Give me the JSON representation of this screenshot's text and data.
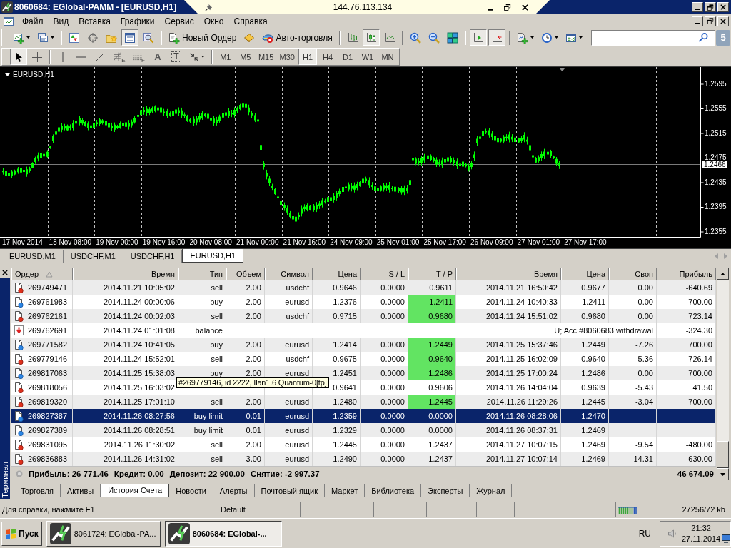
{
  "window": {
    "title": "8060684: EGlobal-PAMM - [EURUSD,H1]"
  },
  "remote_bar": {
    "address": "144.76.113.134"
  },
  "menu": [
    "Файл",
    "Вид",
    "Вставка",
    "Графики",
    "Сервис",
    "Окно",
    "Справка"
  ],
  "toolbar": [
    [
      {
        "kind": "new-chart",
        "on": false
      },
      {
        "kind": "profiles",
        "on": false
      }
    ],
    [
      {
        "kind": "market-watch",
        "on": false
      },
      {
        "kind": "navigator",
        "on": false
      },
      {
        "kind": "favorites",
        "on": false
      },
      {
        "kind": "terminal",
        "on": true
      },
      {
        "kind": "tester",
        "on": false
      }
    ],
    [
      {
        "kind": "new-order",
        "label": "Новый Ордер",
        "on": false
      },
      {
        "kind": "metaeditor",
        "on": false
      },
      {
        "kind": "auto-trading",
        "label": "Авто-торговля",
        "on": false
      }
    ],
    [
      {
        "kind": "bar-chart",
        "on": false
      },
      {
        "kind": "candle-chart",
        "on": true
      },
      {
        "kind": "line-chart",
        "on": false
      }
    ],
    [
      {
        "kind": "zoom-in",
        "on": false
      },
      {
        "kind": "zoom-out",
        "on": false
      },
      {
        "kind": "tile",
        "on": false
      }
    ],
    [
      {
        "kind": "auto-scroll",
        "on": true
      },
      {
        "kind": "chart-shift",
        "on": true
      }
    ],
    [
      {
        "kind": "indicators",
        "on": false
      },
      {
        "kind": "periods",
        "on": false
      },
      {
        "kind": "templates",
        "on": false
      }
    ]
  ],
  "notifications": "5",
  "drawing_tools": [
    [
      {
        "kind": "cursor",
        "on": true
      },
      {
        "kind": "crosshair",
        "on": false
      }
    ],
    [
      {
        "kind": "vertical-line",
        "on": false
      },
      {
        "kind": "horizontal-line",
        "on": false
      },
      {
        "kind": "trend-line",
        "on": false
      },
      {
        "kind": "fibonacci",
        "glyph": "E",
        "on": false
      },
      {
        "kind": "fibonacci-lines",
        "glyph": "F",
        "on": false
      },
      {
        "kind": "text",
        "glyph": "A",
        "on": false
      },
      {
        "kind": "label",
        "glyph": "T",
        "on": false
      },
      {
        "kind": "arrows",
        "on": false
      }
    ]
  ],
  "timeframes": [
    {
      "label": "M1",
      "selected": false
    },
    {
      "label": "M5",
      "selected": false
    },
    {
      "label": "M15",
      "selected": false
    },
    {
      "label": "M30",
      "selected": false
    },
    {
      "label": "H1",
      "selected": true
    },
    {
      "label": "H4",
      "selected": false
    },
    {
      "label": "D1",
      "selected": false
    },
    {
      "label": "W1",
      "selected": false
    },
    {
      "label": "MN",
      "selected": false
    }
  ],
  "chart": {
    "label": "EURUSD,H1",
    "price_scale": [
      "1.2595",
      "1.2555",
      "1.2515",
      "1.2475",
      "1.2435",
      "1.2395",
      "1.2355"
    ],
    "current_price": "1.2466",
    "time_scale": [
      "17 Nov 2014",
      "18 Nov 08:00",
      "19 Nov 00:00",
      "19 Nov 16:00",
      "20 Nov 08:00",
      "21 Nov 00:00",
      "21 Nov 16:00",
      "24 Nov 09:00",
      "25 Nov 01:00",
      "25 Nov 17:00",
      "26 Nov 09:00",
      "27 Nov 01:00",
      "27 Nov 17:00"
    ]
  },
  "chart_tabs": [
    {
      "label": "EURUSD,M1",
      "selected": false
    },
    {
      "label": "USDCHF,M1",
      "selected": false
    },
    {
      "label": "USDCHF,H1",
      "selected": false
    },
    {
      "label": "EURUSD,H1",
      "selected": true
    }
  ],
  "terminal": {
    "title": "Терминал",
    "columns": [
      {
        "label": "Ордер",
        "sorted": true
      },
      {
        "label": "Время",
        "sorted": false
      },
      {
        "label": "Тип",
        "sorted": false
      },
      {
        "label": "Объем",
        "sorted": false
      },
      {
        "label": "Символ",
        "sorted": false
      },
      {
        "label": "Цена",
        "sorted": false
      },
      {
        "label": "S / L",
        "sorted": false
      },
      {
        "label": "T / P",
        "sorted": false
      },
      {
        "label": "Время",
        "sorted": false
      },
      {
        "label": "Цена",
        "sorted": false
      },
      {
        "label": "Своп",
        "sorted": false
      },
      {
        "label": "Прибыль",
        "sorted": false
      }
    ],
    "rows": [
      {
        "kind": "sell",
        "order": "269749471",
        "time": "2014.11.21 10:05:02",
        "type": "sell",
        "volume": "2.00",
        "symbol": "usdchf",
        "price": "0.9646",
        "sl": "0.0000",
        "tp": "0.9611",
        "tp_hit": false,
        "close_time": "2014.11.21 16:50:42",
        "close_price": "0.9677",
        "swap": "0.00",
        "profit": "-640.69",
        "selected": false
      },
      {
        "kind": "buy",
        "order": "269761983",
        "time": "2014.11.24 00:00:06",
        "type": "buy",
        "volume": "2.00",
        "symbol": "eurusd",
        "price": "1.2376",
        "sl": "0.0000",
        "tp": "1.2411",
        "tp_hit": true,
        "close_time": "2014.11.24 10:40:33",
        "close_price": "1.2411",
        "swap": "0.00",
        "profit": "700.00",
        "selected": false
      },
      {
        "kind": "sell",
        "order": "269762161",
        "time": "2014.11.24 00:02:03",
        "type": "sell",
        "volume": "2.00",
        "symbol": "usdchf",
        "price": "0.9715",
        "sl": "0.0000",
        "tp": "0.9680",
        "tp_hit": true,
        "close_time": "2014.11.24 15:51:02",
        "close_price": "0.9680",
        "swap": "0.00",
        "profit": "723.14",
        "selected": false
      },
      {
        "kind": "balance",
        "order": "269762691",
        "time": "2014.11.24 01:01:08",
        "type": "balance",
        "comment": "U; Acc.#8060683 withdrawal",
        "profit": "-324.30",
        "selected": false
      },
      {
        "kind": "buy",
        "order": "269771582",
        "time": "2014.11.24 10:41:05",
        "type": "buy",
        "volume": "2.00",
        "symbol": "eurusd",
        "price": "1.2414",
        "sl": "0.0000",
        "tp": "1.2449",
        "tp_hit": true,
        "close_time": "2014.11.25 15:37:46",
        "close_price": "1.2449",
        "swap": "-7.26",
        "profit": "700.00",
        "selected": false
      },
      {
        "kind": "sell",
        "order": "269779146",
        "time": "2014.11.24 15:52:01",
        "type": "sell",
        "volume": "2.00",
        "symbol": "usdchf",
        "price": "0.9675",
        "sl": "0.0000",
        "tp": "0.9640",
        "tp_hit": true,
        "close_time": "2014.11.25 16:02:09",
        "close_price": "0.9640",
        "swap": "-5.36",
        "profit": "726.14",
        "selected": false
      },
      {
        "kind": "buy",
        "order": "269817063",
        "time": "2014.11.25 15:38:03",
        "type": "buy",
        "volume": "2.00",
        "symbol": "eurusd",
        "price": "1.2451",
        "sl": "0.0000",
        "tp": "1.2486",
        "tp_hit": true,
        "close_time": "2014.11.25 17:00:24",
        "close_price": "1.2486",
        "swap": "0.00",
        "profit": "700.00",
        "selected": false
      },
      {
        "kind": "sell",
        "order": "269818056",
        "time": "2014.11.25 16:03:02",
        "price": "0.9641",
        "sl": "0.0000",
        "tp": "0.9606",
        "tp_hit": false,
        "close_time": "2014.11.26 14:04:04",
        "close_price": "0.9639",
        "swap": "-5.43",
        "profit": "41.50",
        "selected": false
      },
      {
        "kind": "sell",
        "order": "269819320",
        "time": "2014.11.25 17:01:10",
        "type": "sell",
        "volume": "2.00",
        "symbol": "eurusd",
        "price": "1.2480",
        "sl": "0.0000",
        "tp": "1.2445",
        "tp_hit": true,
        "close_time": "2014.11.26 11:29:26",
        "close_price": "1.2445",
        "swap": "-3.04",
        "profit": "700.00",
        "selected": false
      },
      {
        "kind": "buy",
        "order": "269827387",
        "time": "2014.11.26 08:27:56",
        "type": "buy limit",
        "volume": "0.01",
        "symbol": "eurusd",
        "price": "1.2359",
        "sl": "0.0000",
        "tp": "0.0000",
        "tp_hit": false,
        "close_time": "2014.11.26 08:28:06",
        "close_price": "1.2470",
        "selected": true
      },
      {
        "kind": "buy",
        "order": "269827389",
        "time": "2014.11.26 08:28:51",
        "type": "buy limit",
        "volume": "0.01",
        "symbol": "eurusd",
        "price": "1.2329",
        "sl": "0.0000",
        "tp": "0.0000",
        "tp_hit": false,
        "close_time": "2014.11.26 08:37:31",
        "close_price": "1.2469",
        "selected": false
      },
      {
        "kind": "sell",
        "order": "269831095",
        "time": "2014.11.26 11:30:02",
        "type": "sell",
        "volume": "2.00",
        "symbol": "eurusd",
        "price": "1.2445",
        "sl": "0.0000",
        "tp": "1.2437",
        "tp_hit": false,
        "close_time": "2014.11.27 10:07:15",
        "close_price": "1.2469",
        "swap": "-9.54",
        "profit": "-480.00",
        "selected": false
      },
      {
        "kind": "sell",
        "order": "269836883",
        "time": "2014.11.26 14:31:02",
        "type": "sell",
        "volume": "3.00",
        "symbol": "eurusd",
        "price": "1.2490",
        "sl": "0.0000",
        "tp": "1.2437",
        "tp_hit": false,
        "close_time": "2014.11.27 10:07:14",
        "close_price": "1.2469",
        "swap": "-14.31",
        "profit": "630.00",
        "selected": false
      }
    ],
    "summary": [
      "Прибыль: 26 771.46",
      "Кредит: 0.00",
      "Депозит: 22 900.00",
      "Снятие: -2 997.37"
    ],
    "total": "46 674.09",
    "tooltip": "#269779146, id 2222, Ilan1.6 Quantum-0[tp]",
    "tabs": [
      {
        "label": "Торговля",
        "selected": false
      },
      {
        "label": "Активы",
        "selected": false
      },
      {
        "label": "История Счета",
        "selected": true
      },
      {
        "label": "Новости",
        "selected": false
      },
      {
        "label": "Алерты",
        "selected": false
      },
      {
        "label": "Почтовый ящик",
        "selected": false
      },
      {
        "label": "Маркет",
        "selected": false
      },
      {
        "label": "Библиотека",
        "selected": false
      },
      {
        "label": "Эксперты",
        "selected": false
      },
      {
        "label": "Журнал",
        "selected": false
      }
    ]
  },
  "status_bar": {
    "help": "Для справки, нажмите F1",
    "profile": "Default",
    "traffic": "27256/72 kb"
  },
  "taskbar": {
    "start": "Пуск",
    "tasks": [
      {
        "label": "8061724: EGlobal-PA...",
        "selected": false
      },
      {
        "label": "8060684: EGlobal-...",
        "selected": true
      }
    ],
    "language": "RU",
    "time": "21:32",
    "date": "27.11.2014"
  }
}
